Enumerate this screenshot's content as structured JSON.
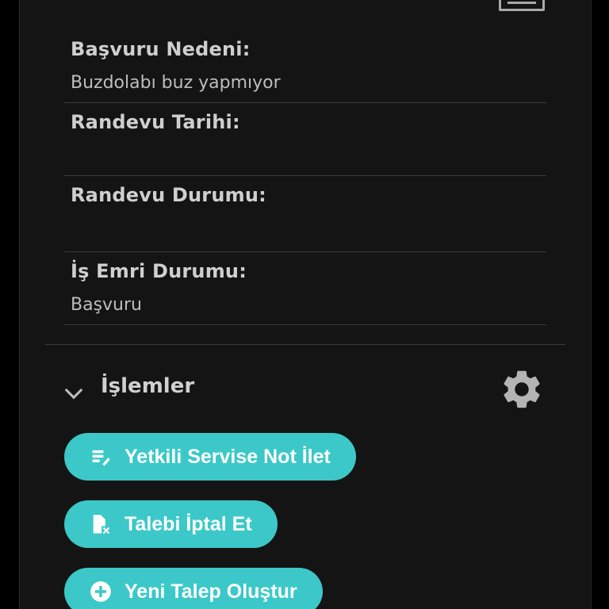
{
  "fields": [
    {
      "label": "Başvuru Nedeni:",
      "value": "Buzdolabı buz yapmıyor"
    },
    {
      "label": "Randevu Tarihi:",
      "value": ""
    },
    {
      "label": "Randevu Durumu:",
      "value": ""
    },
    {
      "label": "İş Emri Durumu:",
      "value": "Başvuru"
    }
  ],
  "section": {
    "title": "İşlemler",
    "collapse_icon": "chevron-down-icon",
    "settings_icon": "gear-icon"
  },
  "actions": [
    {
      "label": "Yetkili Servise Not İlet",
      "icon": "note-edit-icon"
    },
    {
      "label": "Talebi İptal Et",
      "icon": "file-cancel-icon"
    },
    {
      "label": "Yeni Talep Oluştur",
      "icon": "add-circle-icon"
    }
  ],
  "colors": {
    "accent": "#3cc8c8",
    "panel_bg": "#141414",
    "label": "#cfcfcf"
  }
}
